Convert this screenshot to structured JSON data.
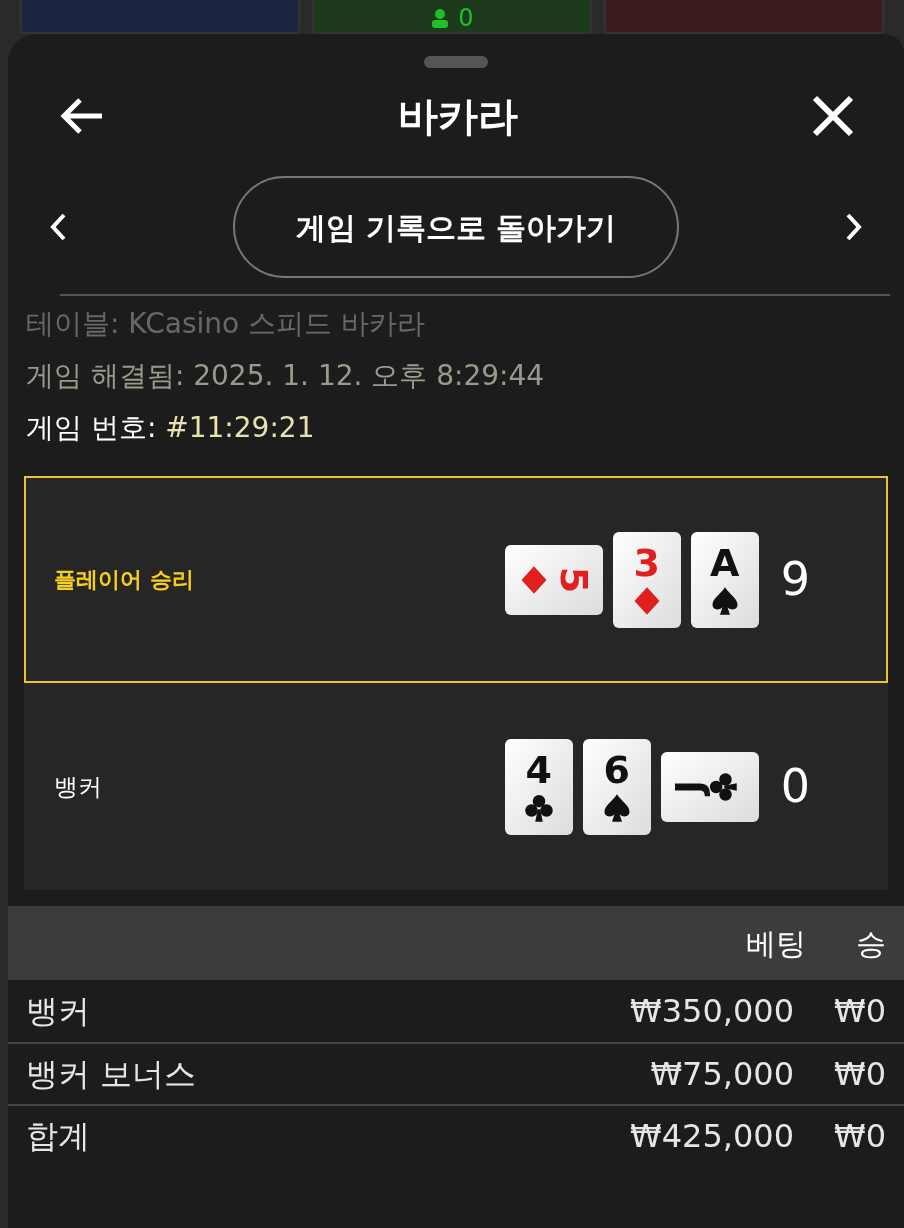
{
  "backdrop": {
    "panels": [
      {
        "color": "#1a2440"
      },
      {
        "color": "#1d3a1d",
        "count": "0"
      },
      {
        "color": "#3a1a1c"
      }
    ]
  },
  "sheet": {
    "title": "바카라",
    "nav_button": "게임 기록으로 돌아가기",
    "info": [
      {
        "label": "테이블: ",
        "value": "KCasino 스피드 바카라",
        "faded": true
      },
      {
        "label": "게임 해결됨: ",
        "value": "2025. 1. 12. 오후 8:29:44",
        "faded": false
      },
      {
        "label": "게임 번호: ",
        "value": "#11:29:21",
        "faded": false
      }
    ],
    "hands": [
      {
        "label": "플레이어 승리",
        "winner": true,
        "score": "9",
        "cards": [
          {
            "rank": "5",
            "kind": "diamonds",
            "rotated": true
          },
          {
            "rank": "3",
            "kind": "diamonds",
            "rotated": false
          },
          {
            "rank": "A",
            "kind": "spades",
            "rotated": false
          }
        ]
      },
      {
        "label": "뱅커",
        "winner": false,
        "score": "0",
        "cards": [
          {
            "rank": "4",
            "kind": "clubs",
            "rotated": false
          },
          {
            "rank": "6",
            "kind": "spades",
            "rotated": false
          },
          {
            "rank": "J",
            "kind": "clubs",
            "rotated": true,
            "counterclockwise": true
          }
        ]
      }
    ],
    "bets": {
      "columns": [
        "베팅",
        "승"
      ],
      "rows": [
        {
          "name": "뱅커",
          "bet": "₩350,000",
          "win": "₩0"
        },
        {
          "name": "뱅커 보너스",
          "bet": "₩75,000",
          "win": "₩0"
        },
        {
          "name": "합계",
          "bet": "₩425,000",
          "win": "₩0"
        }
      ]
    }
  }
}
